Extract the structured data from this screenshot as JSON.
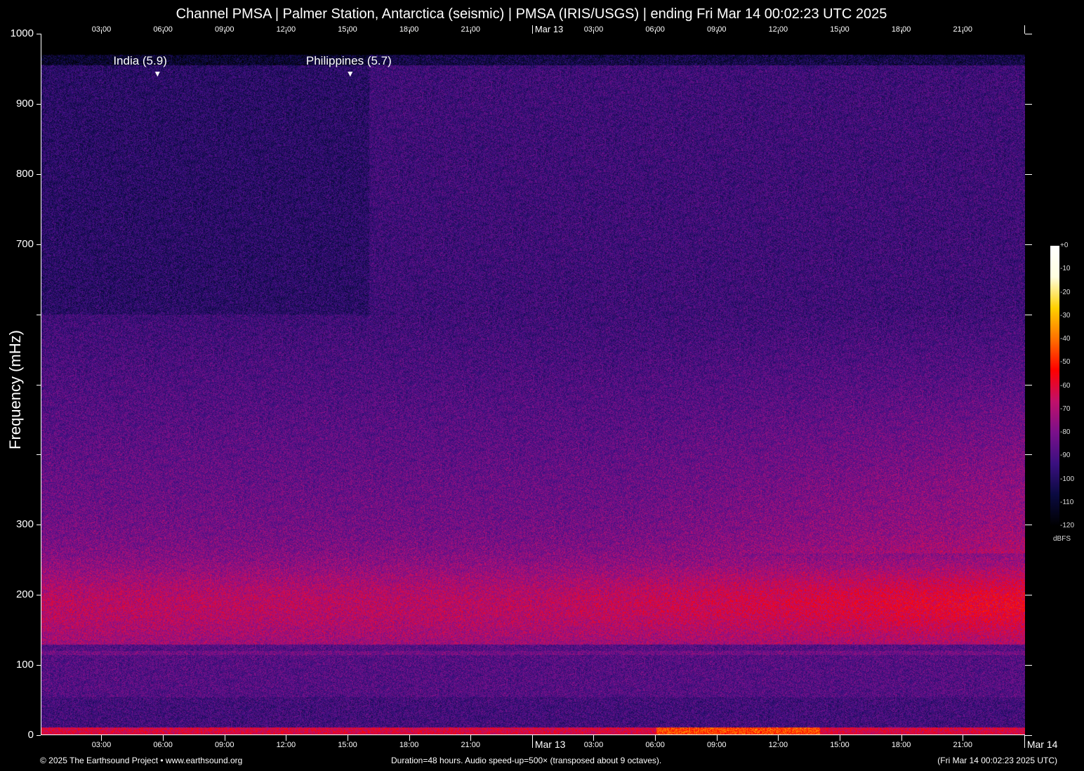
{
  "chart_data": {
    "type": "heatmap",
    "title": "Channel PMSA | Palmer Station, Antarctica (seismic) | PMSA (IRIS/USGS) | ending Fri Mar 14 00:02:23 UTC 2025",
    "ylabel": "Frequency (mHz)",
    "ylim": [
      0,
      1000
    ],
    "y_ticks": [
      0,
      100,
      200,
      300,
      400,
      500,
      600,
      700,
      800,
      900,
      1000
    ],
    "y_tick_labels": [
      "0",
      "100",
      "200",
      "300",
      "",
      "",
      "",
      "700",
      "800",
      "900",
      "1000"
    ],
    "x_range_hours": [
      0,
      48
    ],
    "x_start_offset_hours": 0.04,
    "x_ticks": [
      {
        "hour": 3,
        "label": "03:00"
      },
      {
        "hour": 6,
        "label": "06:00"
      },
      {
        "hour": 9,
        "label": "09:00"
      },
      {
        "hour": 12,
        "label": "12:00"
      },
      {
        "hour": 15,
        "label": "15:00"
      },
      {
        "hour": 18,
        "label": "18:00"
      },
      {
        "hour": 21,
        "label": "21:00"
      },
      {
        "hour": 24,
        "label": "Mar 13"
      },
      {
        "hour": 27,
        "label": "03:00"
      },
      {
        "hour": 30,
        "label": "06:00"
      },
      {
        "hour": 33,
        "label": "09:00"
      },
      {
        "hour": 36,
        "label": "12:00"
      },
      {
        "hour": 39,
        "label": "15:00"
      },
      {
        "hour": 42,
        "label": "18:00"
      },
      {
        "hour": 45,
        "label": "21:00"
      },
      {
        "hour": 48,
        "label": "Mar 14"
      }
    ],
    "events": [
      {
        "label": "India (5.9)",
        "hour": 5.7
      },
      {
        "label": "Philippines (5.7)",
        "hour": 15.1
      }
    ],
    "colorbar": {
      "unit": "dBFS",
      "range": [
        -120,
        0
      ],
      "tick_labels": [
        "+0",
        "-10",
        "-20",
        "-30",
        "-40",
        "-50",
        "-60",
        "-70",
        "-80",
        "-90",
        "-100",
        "-110",
        "-120"
      ]
    },
    "colormap": [
      "#000000",
      "#0a0a40",
      "#3a1080",
      "#7a108a",
      "#c0106a",
      "#ff0000",
      "#ff7000",
      "#ffd000",
      "#ffffe0",
      "#ffffff"
    ]
  },
  "footer": {
    "copyright": "© 2025 The Earthsound Project • www.earthsound.org",
    "info": "Duration=48 hours. Audio speed-up=500× (transposed about 9 octaves).",
    "timestamp": "(Fri Mar 14 00:02:23 2025 UTC)"
  }
}
